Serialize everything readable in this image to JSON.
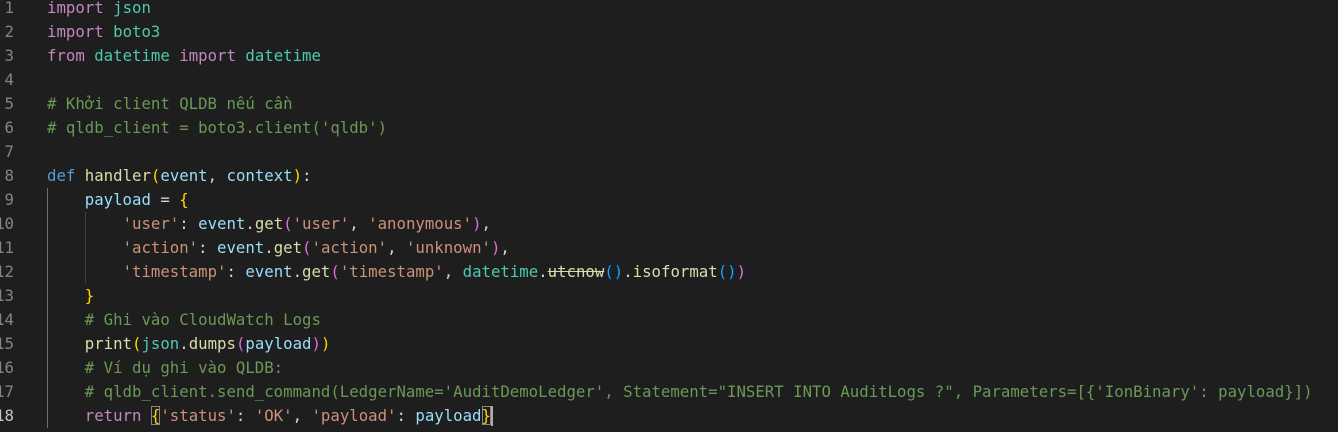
{
  "editor": {
    "active_line": 18,
    "lines": [
      {
        "number": "1",
        "tokens": [
          {
            "t": "import",
            "c": "kw"
          },
          {
            "t": " ",
            "c": "pl"
          },
          {
            "t": "json",
            "c": "mod"
          }
        ]
      },
      {
        "number": "2",
        "tokens": [
          {
            "t": "import",
            "c": "kw"
          },
          {
            "t": " ",
            "c": "pl"
          },
          {
            "t": "boto3",
            "c": "mod"
          }
        ]
      },
      {
        "number": "3",
        "tokens": [
          {
            "t": "from",
            "c": "kw"
          },
          {
            "t": " ",
            "c": "pl"
          },
          {
            "t": "datetime",
            "c": "mod"
          },
          {
            "t": " ",
            "c": "pl"
          },
          {
            "t": "import",
            "c": "kw"
          },
          {
            "t": " ",
            "c": "pl"
          },
          {
            "t": "datetime",
            "c": "mod"
          }
        ]
      },
      {
        "number": "4",
        "tokens": []
      },
      {
        "number": "5",
        "tokens": [
          {
            "t": "# Khởi client QLDB nếu cần",
            "c": "cmt"
          }
        ]
      },
      {
        "number": "6",
        "tokens": [
          {
            "t": "# qldb_client = boto3.client('qldb')",
            "c": "cmt"
          }
        ]
      },
      {
        "number": "7",
        "tokens": []
      },
      {
        "number": "8",
        "tokens": [
          {
            "t": "def",
            "c": "def"
          },
          {
            "t": " ",
            "c": "pl"
          },
          {
            "t": "handler",
            "c": "fn"
          },
          {
            "t": "(",
            "c": "b1"
          },
          {
            "t": "event",
            "c": "var"
          },
          {
            "t": ", ",
            "c": "pl"
          },
          {
            "t": "context",
            "c": "var"
          },
          {
            "t": ")",
            "c": "b1"
          },
          {
            "t": ":",
            "c": "pl"
          }
        ]
      },
      {
        "number": "9",
        "tokens": [
          {
            "t": "    ",
            "c": "pl"
          },
          {
            "t": "payload",
            "c": "var"
          },
          {
            "t": " = ",
            "c": "pl"
          },
          {
            "t": "{",
            "c": "b1"
          }
        ]
      },
      {
        "number": "10",
        "tokens": [
          {
            "t": "        ",
            "c": "pl"
          },
          {
            "t": "'user'",
            "c": "str"
          },
          {
            "t": ": ",
            "c": "pl"
          },
          {
            "t": "event",
            "c": "var"
          },
          {
            "t": ".",
            "c": "pl"
          },
          {
            "t": "get",
            "c": "fn"
          },
          {
            "t": "(",
            "c": "b2"
          },
          {
            "t": "'user'",
            "c": "str"
          },
          {
            "t": ", ",
            "c": "pl"
          },
          {
            "t": "'anonymous'",
            "c": "str"
          },
          {
            "t": ")",
            "c": "b2"
          },
          {
            "t": ",",
            "c": "pl"
          }
        ]
      },
      {
        "number": "11",
        "tokens": [
          {
            "t": "        ",
            "c": "pl"
          },
          {
            "t": "'action'",
            "c": "str"
          },
          {
            "t": ": ",
            "c": "pl"
          },
          {
            "t": "event",
            "c": "var"
          },
          {
            "t": ".",
            "c": "pl"
          },
          {
            "t": "get",
            "c": "fn"
          },
          {
            "t": "(",
            "c": "b2"
          },
          {
            "t": "'action'",
            "c": "str"
          },
          {
            "t": ", ",
            "c": "pl"
          },
          {
            "t": "'unknown'",
            "c": "str"
          },
          {
            "t": ")",
            "c": "b2"
          },
          {
            "t": ",",
            "c": "pl"
          }
        ]
      },
      {
        "number": "12",
        "tokens": [
          {
            "t": "        ",
            "c": "pl"
          },
          {
            "t": "'timestamp'",
            "c": "str"
          },
          {
            "t": ": ",
            "c": "pl"
          },
          {
            "t": "event",
            "c": "var"
          },
          {
            "t": ".",
            "c": "pl"
          },
          {
            "t": "get",
            "c": "fn"
          },
          {
            "t": "(",
            "c": "b2"
          },
          {
            "t": "'timestamp'",
            "c": "str"
          },
          {
            "t": ", ",
            "c": "pl"
          },
          {
            "t": "datetime",
            "c": "mod"
          },
          {
            "t": ".",
            "c": "pl"
          },
          {
            "t": "utcnow",
            "c": "fn strike"
          },
          {
            "t": "()",
            "c": "b3"
          },
          {
            "t": ".",
            "c": "pl"
          },
          {
            "t": "isoformat",
            "c": "fn"
          },
          {
            "t": "()",
            "c": "b3"
          },
          {
            "t": ")",
            "c": "b2"
          }
        ]
      },
      {
        "number": "13",
        "tokens": [
          {
            "t": "    ",
            "c": "pl"
          },
          {
            "t": "}",
            "c": "b1"
          }
        ]
      },
      {
        "number": "14",
        "tokens": [
          {
            "t": "    ",
            "c": "pl"
          },
          {
            "t": "# Ghi vào CloudWatch Logs",
            "c": "cmt"
          }
        ]
      },
      {
        "number": "15",
        "tokens": [
          {
            "t": "    ",
            "c": "pl"
          },
          {
            "t": "print",
            "c": "fn"
          },
          {
            "t": "(",
            "c": "b1"
          },
          {
            "t": "json",
            "c": "mod"
          },
          {
            "t": ".",
            "c": "pl"
          },
          {
            "t": "dumps",
            "c": "fn"
          },
          {
            "t": "(",
            "c": "b2"
          },
          {
            "t": "payload",
            "c": "var"
          },
          {
            "t": ")",
            "c": "b2"
          },
          {
            "t": ")",
            "c": "b1"
          }
        ]
      },
      {
        "number": "16",
        "tokens": [
          {
            "t": "    ",
            "c": "pl"
          },
          {
            "t": "# Ví dụ ghi vào QLDB:",
            "c": "cmt"
          }
        ]
      },
      {
        "number": "17",
        "tokens": [
          {
            "t": "    ",
            "c": "pl"
          },
          {
            "t": "# qldb_client.send_command(LedgerName='AuditDemoLedger', Statement=\"INSERT INTO AuditLogs ?\", Parameters=[{'IonBinary': payload}])",
            "c": "cmt"
          }
        ]
      },
      {
        "number": "18",
        "tokens": [
          {
            "t": "    ",
            "c": "pl"
          },
          {
            "t": "return",
            "c": "kw"
          },
          {
            "t": " ",
            "c": "pl"
          },
          {
            "t": "{",
            "c": "b1 bmatch"
          },
          {
            "t": "'status'",
            "c": "str"
          },
          {
            "t": ": ",
            "c": "pl"
          },
          {
            "t": "'OK'",
            "c": "str"
          },
          {
            "t": ", ",
            "c": "pl"
          },
          {
            "t": "'payload'",
            "c": "str"
          },
          {
            "t": ": ",
            "c": "pl"
          },
          {
            "t": "payload",
            "c": "var"
          },
          {
            "t": "}",
            "c": "b1 bmatch"
          }
        ]
      }
    ]
  }
}
